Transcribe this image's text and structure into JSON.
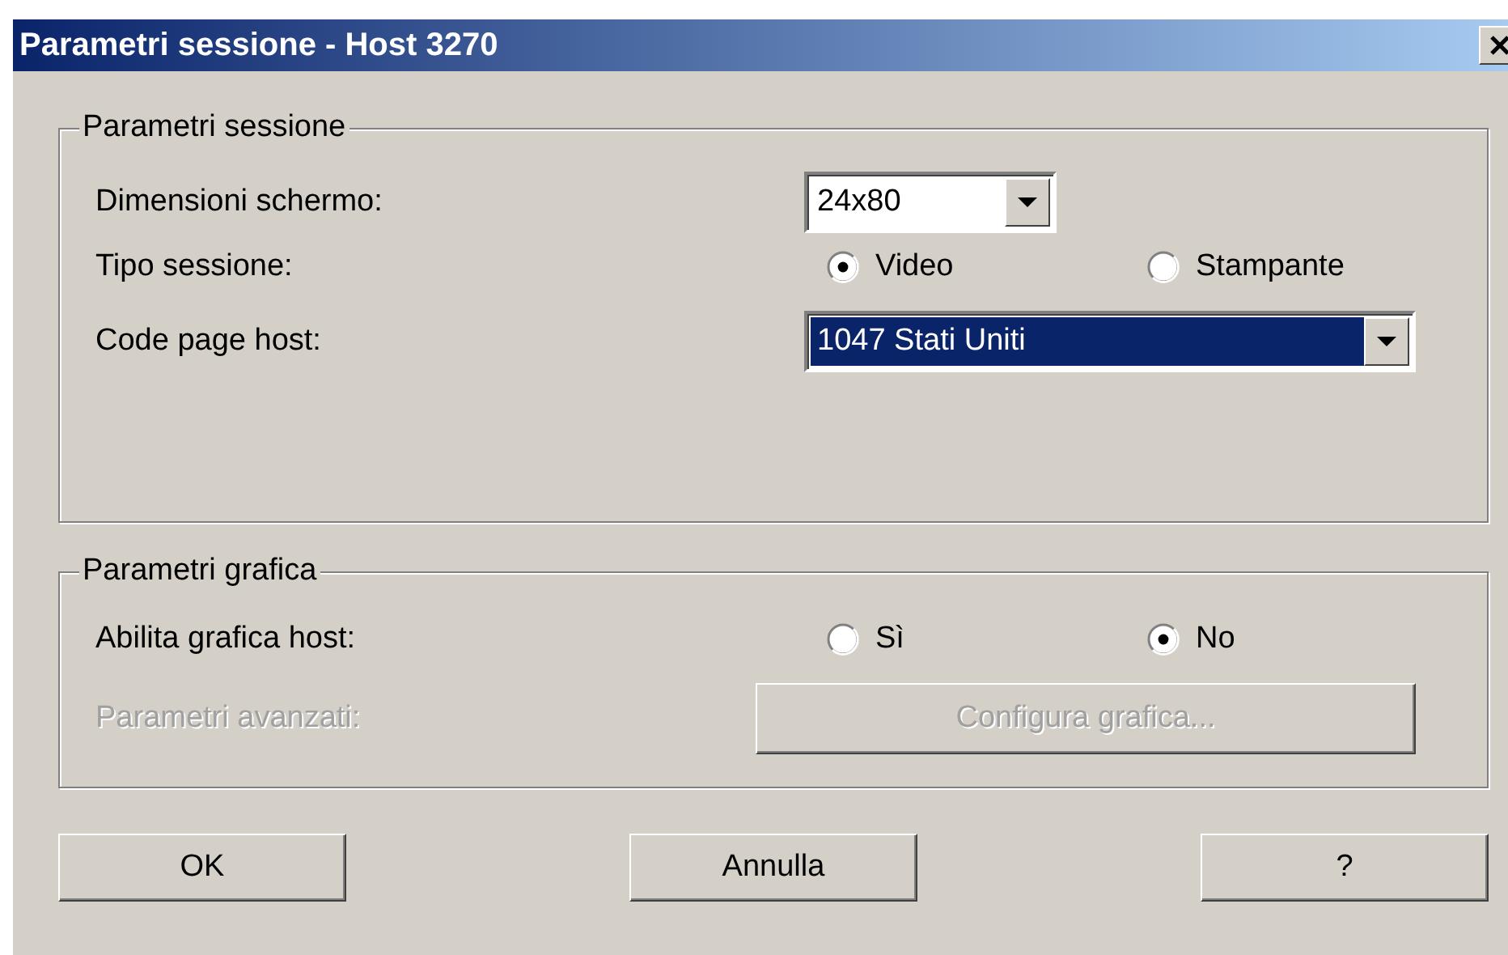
{
  "window": {
    "title": "Parametri sessione - Host 3270"
  },
  "groups": [
    {
      "title": "Parametri sessione",
      "rows": [
        {
          "kind": "combo",
          "label": "Dimensioni schermo:",
          "value": "24x80",
          "highlighted": false
        },
        {
          "kind": "radio",
          "label": "Tipo sessione:",
          "options": [
            {
              "label": "Video",
              "selected": true
            },
            {
              "label": "Stampante",
              "selected": false
            }
          ]
        },
        {
          "kind": "wide-combo",
          "label": "Code page host:",
          "value": "1047 Stati Uniti",
          "highlighted": true
        }
      ]
    },
    {
      "title": "Parametri grafica",
      "rows": [
        {
          "kind": "radio",
          "label": "Abilita grafica host:",
          "options": [
            {
              "label": "Sì",
              "selected": false
            },
            {
              "label": "No",
              "selected": true
            }
          ]
        },
        {
          "kind": "button",
          "label": "Parametri avanzati:",
          "button": "Configura grafica...",
          "disabled": true
        }
      ]
    }
  ],
  "buttons": [
    "OK",
    "Annulla",
    "?"
  ]
}
